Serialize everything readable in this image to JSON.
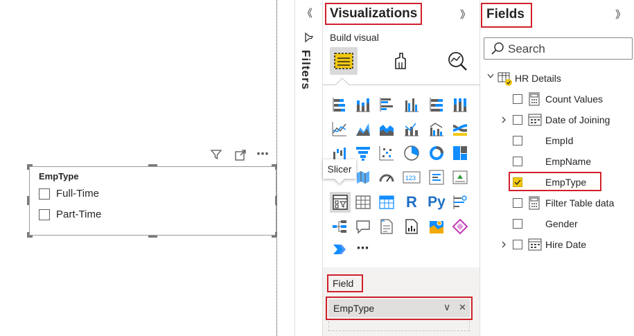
{
  "canvas": {
    "slicer": {
      "title": "EmpType",
      "options": [
        "Full-Time",
        "Part-Time"
      ]
    },
    "toolbar_icons": [
      "filter-icon",
      "focus-mode-icon",
      "more-options-icon"
    ],
    "more_glyph": "⋯"
  },
  "filters": {
    "label": "Filters",
    "collapse_glyph": "《"
  },
  "visualizations": {
    "title": "Visualizations",
    "expand_glyph": "》",
    "build_visual_label": "Build visual",
    "tooltip": "Slicer",
    "r_label": "R",
    "py_label": "Py",
    "more_glyph": "⋯",
    "field_section_label": "Field",
    "field_value": "EmpType",
    "chevron_glyph": "∨",
    "remove_glyph": "✕"
  },
  "fields": {
    "title": "Fields",
    "expand_glyph": "》",
    "search_placeholder": "Search",
    "table_name": "HR Details",
    "items": [
      {
        "label": "Count Values",
        "checked": false,
        "icon": "calculator-icon",
        "expandable": false
      },
      {
        "label": "Date of Joining",
        "checked": false,
        "icon": "calendar-icon",
        "expandable": true
      },
      {
        "label": "EmpId",
        "checked": false,
        "icon": "",
        "expandable": false
      },
      {
        "label": "EmpName",
        "checked": false,
        "icon": "",
        "expandable": false
      },
      {
        "label": "EmpType",
        "checked": true,
        "icon": "",
        "expandable": false
      },
      {
        "label": "Filter Table data",
        "checked": false,
        "icon": "calculator-icon",
        "expandable": false
      },
      {
        "label": "Gender",
        "checked": false,
        "icon": "",
        "expandable": false
      },
      {
        "label": "Hire Date",
        "checked": false,
        "icon": "calendar-icon",
        "expandable": true
      }
    ]
  },
  "colors": {
    "accent_yellow": "#f2c811",
    "highlight_red": "#d0202a",
    "icon_blue": "#118dff",
    "icon_dark": "#605e5c"
  }
}
